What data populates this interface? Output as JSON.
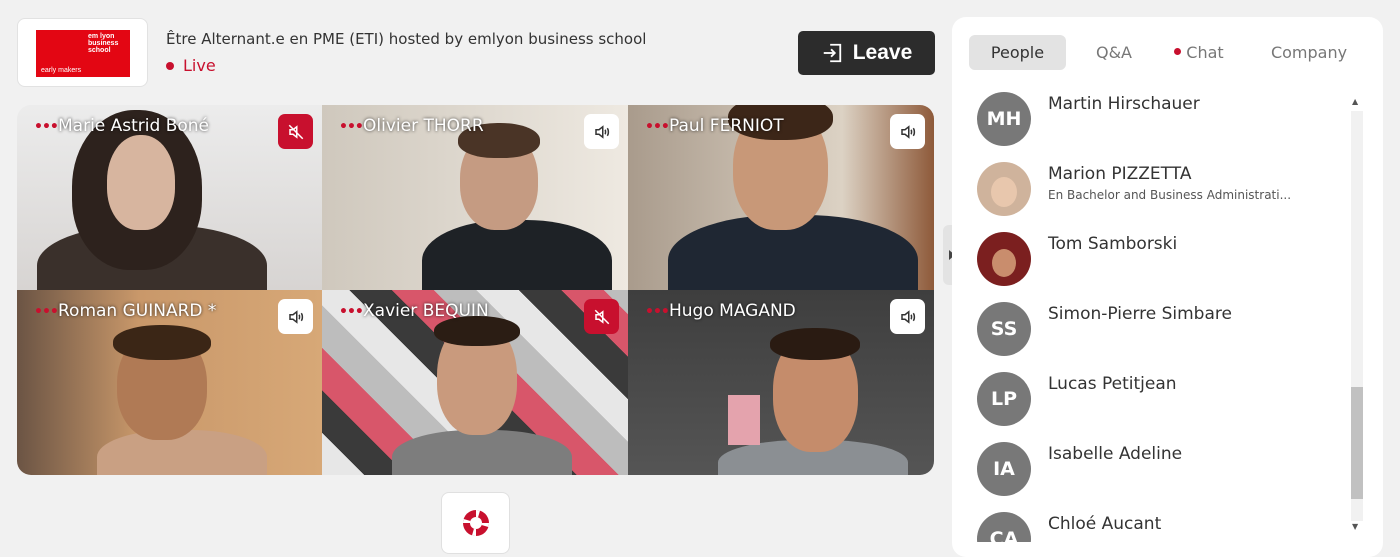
{
  "header": {
    "logo_left_text": "early makers",
    "logo_right_text": "em lyon business school",
    "event_title": "Être Alternant.e en PME (ETI)",
    "hosted_by_label": "hosted by",
    "host": "emlyon business school",
    "status": "Live",
    "leave_label": "Leave"
  },
  "participants": [
    {
      "name": "Marie Astrid Boné",
      "audio": "muted",
      "dots": "•••"
    },
    {
      "name": "Olivier THORR",
      "audio": "on",
      "dots": "•••"
    },
    {
      "name": "Paul FERNIOT",
      "audio": "on",
      "dots": "•••"
    },
    {
      "name": "Roman GUINARD *",
      "audio": "on",
      "dots": "•••"
    },
    {
      "name": "Xavier BEQUIN",
      "audio": "muted",
      "dots": "•••"
    },
    {
      "name": "Hugo MAGAND",
      "audio": "on",
      "dots": "•••"
    }
  ],
  "tabs": [
    {
      "label": "People",
      "active": true
    },
    {
      "label": "Q&A"
    },
    {
      "label": "Chat",
      "notification": true
    },
    {
      "label": "Company"
    }
  ],
  "people": [
    {
      "initials": "MH",
      "name": "Martin Hirschauer",
      "subtitle": ""
    },
    {
      "initials": "",
      "name": "Marion PIZZETTA",
      "subtitle": "En Bachelor and Business Administrati...",
      "photo": true
    },
    {
      "initials": "",
      "name": "Tom Samborski",
      "subtitle": "",
      "photo": true
    },
    {
      "initials": "SS",
      "name": "Simon-Pierre Simbare",
      "subtitle": ""
    },
    {
      "initials": "LP",
      "name": "Lucas Petitjean",
      "subtitle": ""
    },
    {
      "initials": "IA",
      "name": "Isabelle Adeline",
      "subtitle": ""
    },
    {
      "initials": "CA",
      "name": "Chloé Aucant",
      "subtitle": ""
    }
  ],
  "colors": {
    "brand_red": "#c8102e",
    "logo_red": "#e30613",
    "leave_bg": "#2c2c2c"
  }
}
